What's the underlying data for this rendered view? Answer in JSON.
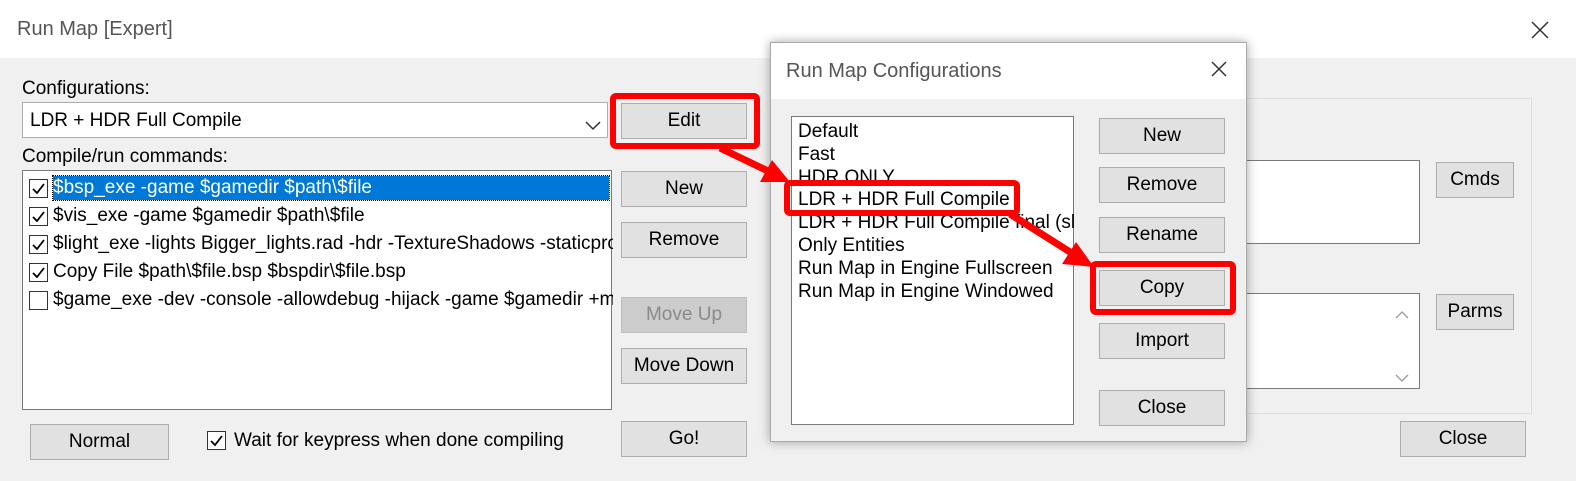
{
  "main_window": {
    "title": "Run Map [Expert]",
    "configurations_label": "Configurations:",
    "selected_configuration": "LDR + HDR Full Compile",
    "commands_label": "Compile/run commands:",
    "commands": [
      {
        "text": "$bsp_exe -game $gamedir $path\\$file",
        "checked": true,
        "selected": true
      },
      {
        "text": "$vis_exe -game $gamedir $path\\$file",
        "checked": true,
        "selected": false
      },
      {
        "text": "$light_exe -lights Bigger_lights.rad -hdr -TextureShadows -staticpropl",
        "checked": true,
        "selected": false
      },
      {
        "text": "Copy File $path\\$file.bsp $bspdir\\$file.bsp",
        "checked": true,
        "selected": false
      },
      {
        "text": "$game_exe -dev -console -allowdebug -hijack -game $gamedir +map",
        "checked": false,
        "selected": false
      }
    ],
    "buttons": {
      "edit": "Edit",
      "new": "New",
      "remove": "Remove",
      "move_up": "Move Up",
      "move_down": "Move Down",
      "go": "Go!",
      "normal": "Normal",
      "cmds": "Cmds",
      "parms": "Parms",
      "close": "Close"
    },
    "wait_keypress_label": "Wait for keypress when done compiling",
    "wait_keypress_checked": true
  },
  "config_dialog": {
    "title": "Run Map Configurations",
    "items": [
      "Default",
      "Fast",
      "HDR ONLY",
      "LDR + HDR Full Compile",
      "LDR + HDR Full Compile final (sl",
      "Only Entities",
      "Run Map in Engine Fullscreen",
      "Run Map in Engine Windowed"
    ],
    "highlighted_item": 3,
    "buttons": {
      "new": "New",
      "remove": "Remove",
      "rename": "Rename",
      "copy": "Copy",
      "import": "Import",
      "close": "Close"
    }
  },
  "annotation_color": "#ff0000",
  "selection_color": "#0078d7"
}
